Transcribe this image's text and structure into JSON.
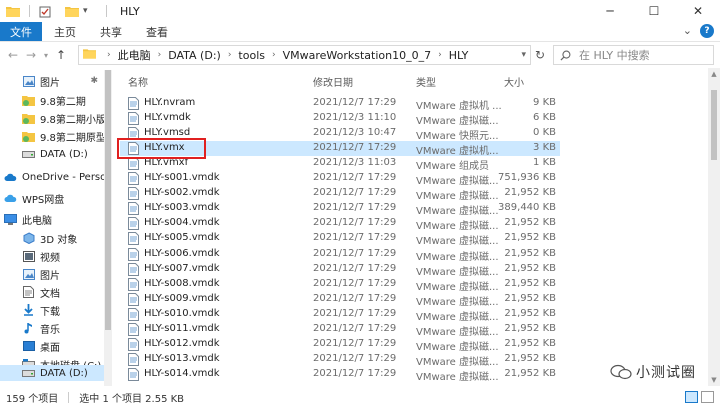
{
  "window": {
    "title": "HLY"
  },
  "ribbon": {
    "tabs": [
      "文件",
      "主页",
      "共享",
      "查看"
    ]
  },
  "address": {
    "crumbs": [
      "此电脑",
      "DATA (D:)",
      "tools",
      "VMwareWorkstation10_0_7",
      "HLY"
    ]
  },
  "search": {
    "placeholder": "在 HLY 中搜索"
  },
  "sidebar": {
    "items": [
      {
        "label": "图片",
        "icon": "pictures-icon",
        "pinned": true
      },
      {
        "label": "9.8第二期",
        "icon": "folder-icon"
      },
      {
        "label": "9.8第二期小版本",
        "icon": "folder-icon"
      },
      {
        "label": "9.8第二期原型",
        "icon": "folder-icon"
      },
      {
        "label": "DATA (D:)",
        "icon": "drive-icon"
      },
      {
        "label": "OneDrive - Perso",
        "icon": "cloud-icon"
      },
      {
        "label": "WPS网盘",
        "icon": "cloud-icon"
      },
      {
        "label": "此电脑",
        "icon": "computer-icon"
      },
      {
        "label": "3D 对象",
        "icon": "3d-objects-icon"
      },
      {
        "label": "视频",
        "icon": "videos-icon"
      },
      {
        "label": "图片",
        "icon": "pictures-icon"
      },
      {
        "label": "文档",
        "icon": "documents-icon"
      },
      {
        "label": "下载",
        "icon": "downloads-icon"
      },
      {
        "label": "音乐",
        "icon": "music-icon"
      },
      {
        "label": "桌面",
        "icon": "desktop-icon"
      },
      {
        "label": "本地磁盘 (C:)",
        "icon": "drive-icon"
      },
      {
        "label": "DATA (D:)",
        "icon": "drive-icon",
        "selected": true
      }
    ]
  },
  "columns": {
    "name": "名称",
    "date": "修改日期",
    "type": "类型",
    "size": "大小"
  },
  "files": [
    {
      "name": "HLY.nvram",
      "date": "2021/12/7 17:29",
      "type": "VMware 虚拟机 ...",
      "size": "9 KB"
    },
    {
      "name": "HLY.vmdk",
      "date": "2021/12/3 11:10",
      "type": "VMware 虚拟磁...",
      "size": "6 KB"
    },
    {
      "name": "HLY.vmsd",
      "date": "2021/12/3 10:47",
      "type": "VMware 快照元...",
      "size": "0 KB"
    },
    {
      "name": "HLY.vmx",
      "date": "2021/12/7 17:29",
      "type": "VMware 虚拟机...",
      "size": "3 KB",
      "selected": true
    },
    {
      "name": "HLY.vmxf",
      "date": "2021/12/3 11:03",
      "type": "VMware 组成员",
      "size": "1 KB"
    },
    {
      "name": "HLY-s001.vmdk",
      "date": "2021/12/7 17:29",
      "type": "VMware 虚拟磁...",
      "size": "751,936 KB"
    },
    {
      "name": "HLY-s002.vmdk",
      "date": "2021/12/7 17:29",
      "type": "VMware 虚拟磁...",
      "size": "21,952 KB"
    },
    {
      "name": "HLY-s003.vmdk",
      "date": "2021/12/7 17:29",
      "type": "VMware 虚拟磁...",
      "size": "389,440 KB"
    },
    {
      "name": "HLY-s004.vmdk",
      "date": "2021/12/7 17:29",
      "type": "VMware 虚拟磁...",
      "size": "21,952 KB"
    },
    {
      "name": "HLY-s005.vmdk",
      "date": "2021/12/7 17:29",
      "type": "VMware 虚拟磁...",
      "size": "21,952 KB"
    },
    {
      "name": "HLY-s006.vmdk",
      "date": "2021/12/7 17:29",
      "type": "VMware 虚拟磁...",
      "size": "21,952 KB"
    },
    {
      "name": "HLY-s007.vmdk",
      "date": "2021/12/7 17:29",
      "type": "VMware 虚拟磁...",
      "size": "21,952 KB"
    },
    {
      "name": "HLY-s008.vmdk",
      "date": "2021/12/7 17:29",
      "type": "VMware 虚拟磁...",
      "size": "21,952 KB"
    },
    {
      "name": "HLY-s009.vmdk",
      "date": "2021/12/7 17:29",
      "type": "VMware 虚拟磁...",
      "size": "21,952 KB"
    },
    {
      "name": "HLY-s010.vmdk",
      "date": "2021/12/7 17:29",
      "type": "VMware 虚拟磁...",
      "size": "21,952 KB"
    },
    {
      "name": "HLY-s011.vmdk",
      "date": "2021/12/7 17:29",
      "type": "VMware 虚拟磁...",
      "size": "21,952 KB"
    },
    {
      "name": "HLY-s012.vmdk",
      "date": "2021/12/7 17:29",
      "type": "VMware 虚拟磁...",
      "size": "21,952 KB"
    },
    {
      "name": "HLY-s013.vmdk",
      "date": "2021/12/7 17:29",
      "type": "VMware 虚拟磁...",
      "size": "21,952 KB"
    },
    {
      "name": "HLY-s014.vmdk",
      "date": "2021/12/7 17:29",
      "type": "VMware 虚拟磁...",
      "size": "21,952 KB"
    }
  ],
  "status": {
    "count": "159 个项目",
    "selected": "选中 1 个项目  2.55 KB"
  },
  "watermark": {
    "text": "小测试圈"
  },
  "colors": {
    "accent": "#1979ca",
    "selection": "#cce8ff",
    "highlight_box": "#e02020"
  }
}
